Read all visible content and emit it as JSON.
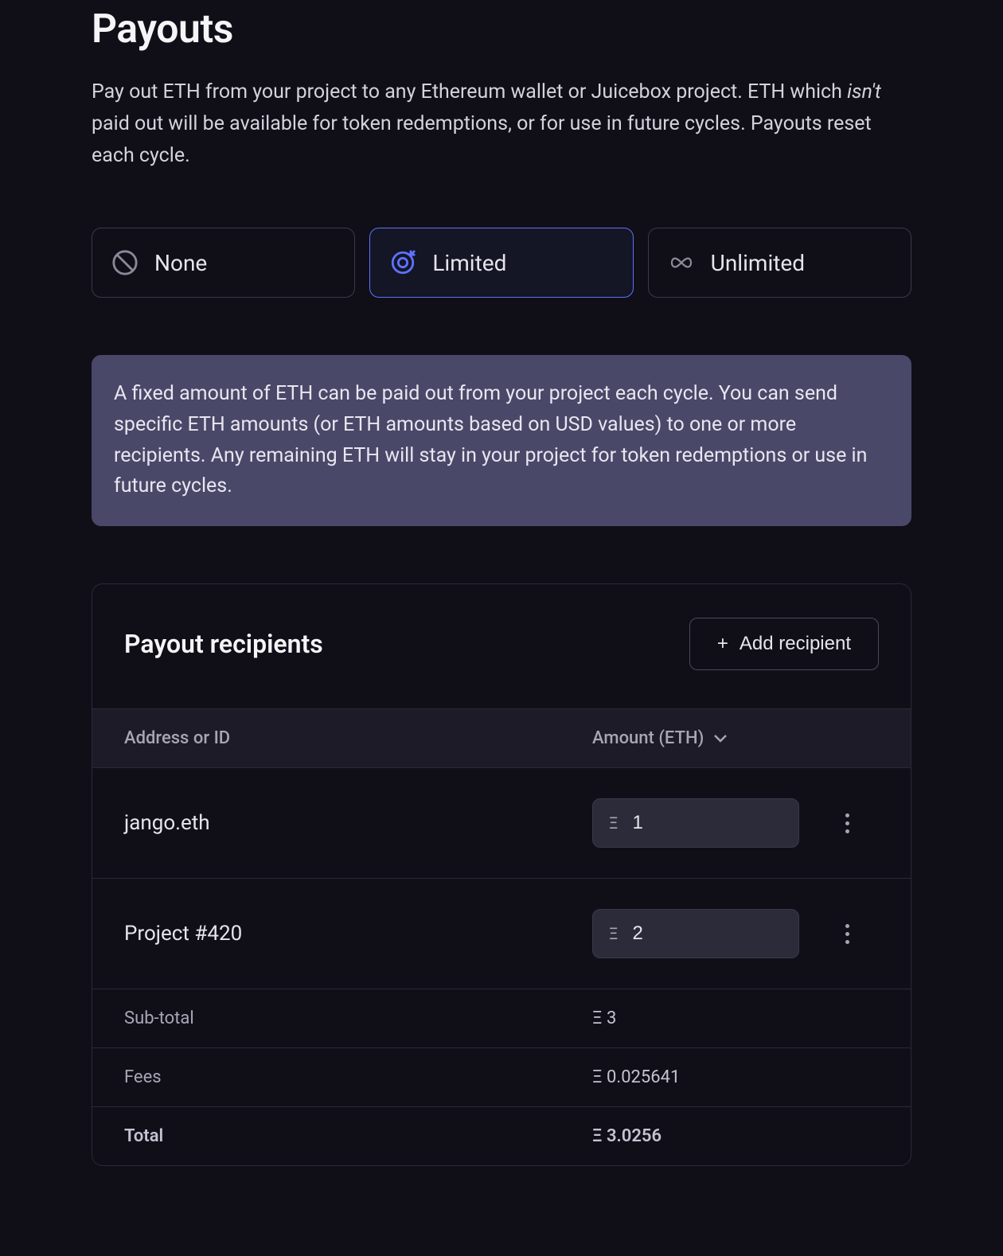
{
  "page": {
    "title": "Payouts",
    "description_pre": "Pay out ETH from your project to any Ethereum wallet or Juicebox project. ETH which ",
    "description_em": "isn't",
    "description_post": " paid out will be available for token redemptions, or for use in future cycles. Payouts reset each cycle."
  },
  "options": {
    "none": "None",
    "limited": "Limited",
    "unlimited": "Unlimited",
    "selected": "limited"
  },
  "info_text": "A fixed amount of ETH can be paid out from your project each cycle. You can send specific ETH amounts (or ETH amounts based on USD values) to one or more recipients. Any remaining ETH will stay in your project for token redemptions or use in future cycles.",
  "recipients": {
    "heading": "Payout recipients",
    "add_label": "Add recipient",
    "col_address": "Address or ID",
    "col_amount": "Amount (ETH)",
    "rows": [
      {
        "name": "jango.eth",
        "amount": "1"
      },
      {
        "name": "Project #420",
        "amount": "2"
      }
    ],
    "subtotal_label": "Sub-total",
    "subtotal_value": "Ξ 3",
    "fees_label": "Fees",
    "fees_value": "Ξ 0.025641",
    "total_label": "Total",
    "total_value": "Ξ 3.0256",
    "eth_symbol": "Ξ"
  }
}
